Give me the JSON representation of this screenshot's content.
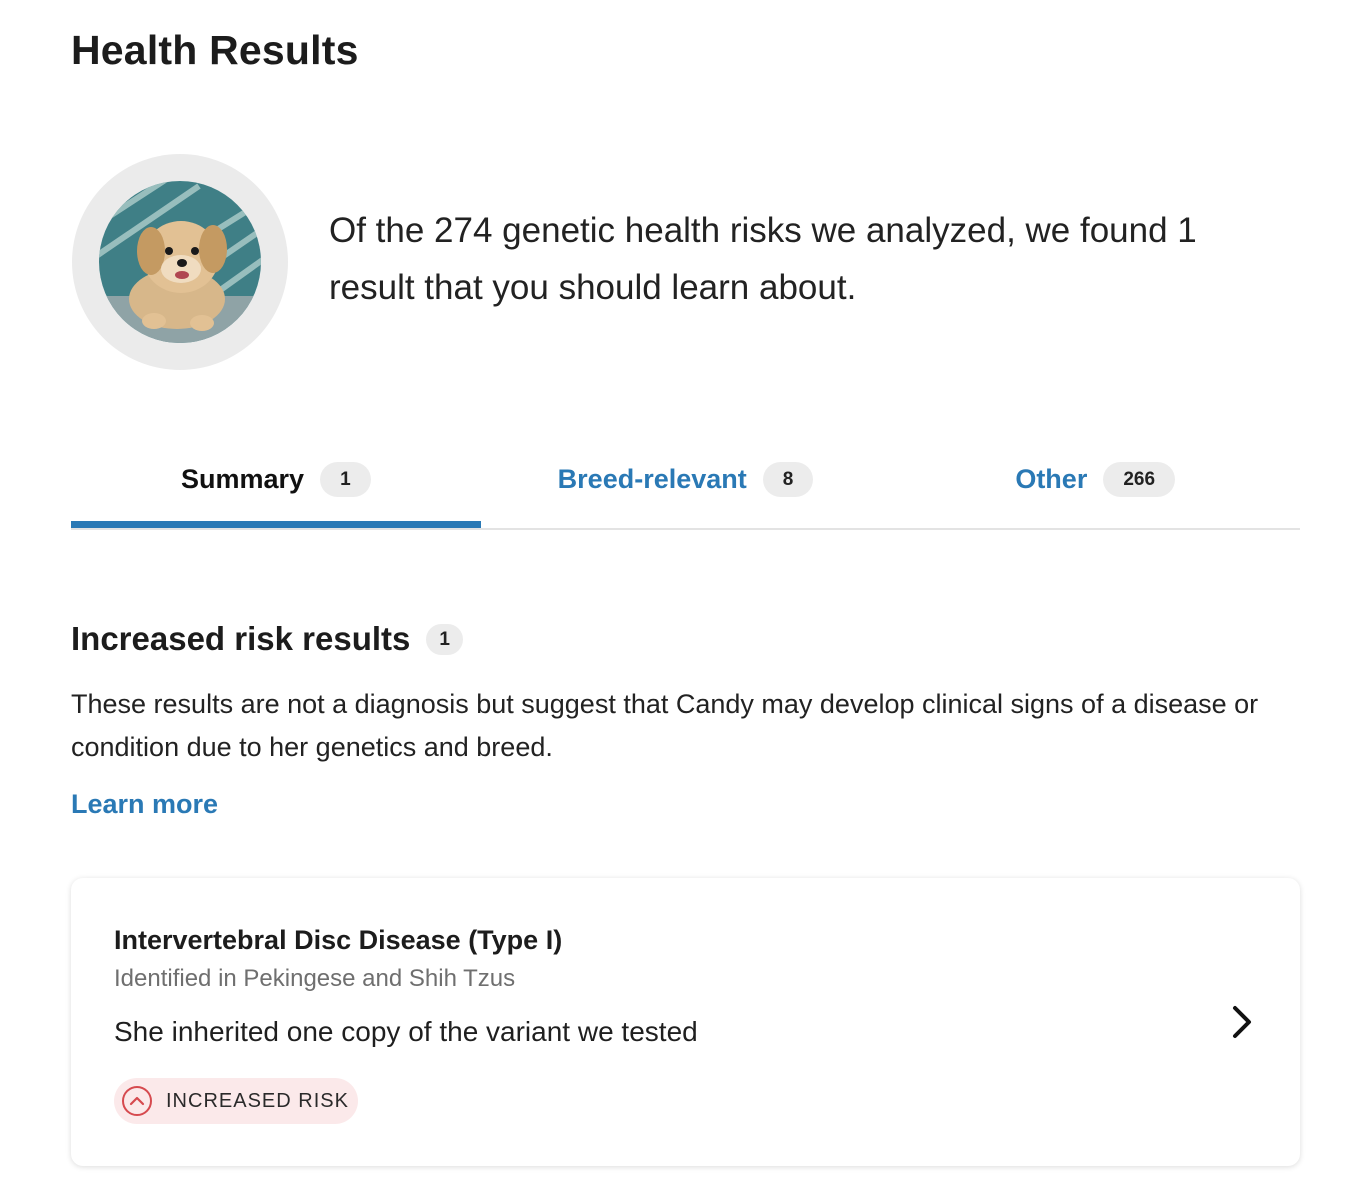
{
  "page": {
    "title": "Health Results"
  },
  "summary": {
    "text": "Of the 274 genetic health risks we analyzed, we found 1 result that you should learn about."
  },
  "tabs": [
    {
      "label": "Summary",
      "count": "1",
      "active": true
    },
    {
      "label": "Breed-relevant",
      "count": "8",
      "active": false
    },
    {
      "label": "Other",
      "count": "266",
      "active": false
    }
  ],
  "section": {
    "title": "Increased risk results",
    "count": "1",
    "description": "These results are not a diagnosis but suggest that Candy may develop clinical signs of a disease or condition due to her genetics and breed.",
    "learn_more": "Learn more"
  },
  "result_card": {
    "title": "Intervertebral Disc Disease (Type I)",
    "subtitle": "Identified in Pekingese and Shih Tzus",
    "description": "She inherited one copy of the variant we tested",
    "badge_label": "INCREASED RISK",
    "badge_icon": "chevron-up-circle-icon",
    "action_icon": "chevron-right-icon"
  },
  "colors": {
    "link": "#2a79b5",
    "active_tab_underline": "#2a79b5",
    "pill_bg": "#ececec",
    "risk_bg": "#fbe9ea",
    "risk_icon": "#d64a4f"
  }
}
